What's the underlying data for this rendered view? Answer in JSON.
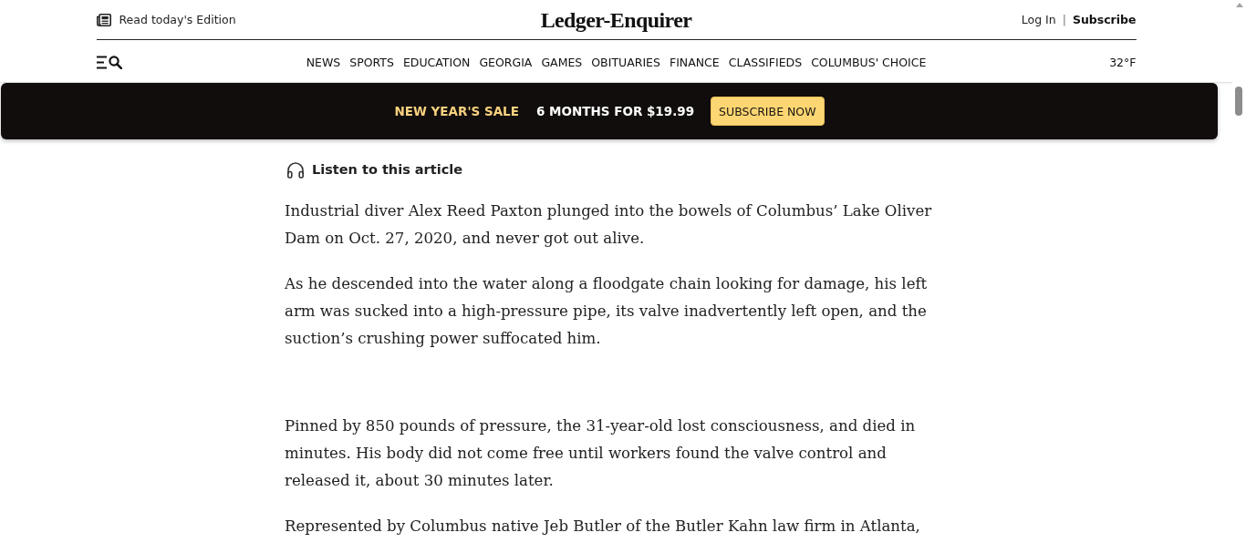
{
  "header": {
    "edition_link": "Read today's Edition",
    "logo": "Ledger-Enquirer",
    "login": "Log In",
    "separator": "|",
    "subscribe": "Subscribe"
  },
  "nav": {
    "items": [
      "NEWS",
      "SPORTS",
      "EDUCATION",
      "GEORGIA",
      "GAMES",
      "OBITUARIES",
      "FINANCE",
      "CLASSIFIEDS",
      "COLUMBUS' CHOICE"
    ],
    "temperature": "32°F"
  },
  "promo": {
    "sale": "NEW YEAR'S SALE",
    "offer": "6 MONTHS FOR $19.99",
    "button": "SUBSCRIBE NOW"
  },
  "article": {
    "listen": "Listen to this article",
    "paragraphs": [
      "Industrial diver Alex Reed Paxton plunged into the bowels of Columbus’ Lake Oliver Dam on Oct. 27, 2020, and never got out alive.",
      "As he descended into the water along a floodgate chain looking for damage, his left arm was sucked into a high-pressure pipe, its valve inadvertently left open, and the suction’s crushing power suffocated him.",
      "Pinned by 850 pounds of pressure, the 31-year-old lost consciousness, and died in minutes. His body did not come free until workers found the valve control and released it, about 30 minutes later.",
      "Represented by Columbus native Jeb Butler of the Butler Kahn law firm in Atlanta,"
    ]
  }
}
